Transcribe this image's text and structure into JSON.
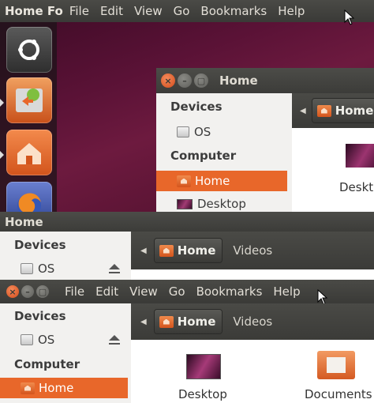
{
  "panel1": {
    "topbar": {
      "app_title": "Home Fo",
      "menu": [
        "File",
        "Edit",
        "View",
        "Go",
        "Bookmarks",
        "Help"
      ]
    },
    "window": {
      "title": "Home",
      "sidebar": {
        "devices_header": "Devices",
        "os_label": "OS",
        "computer_header": "Computer",
        "home_label": "Home",
        "desktop_label": "Desktop"
      },
      "breadcrumb": "Home",
      "content_item": "Deskt"
    }
  },
  "panel2": {
    "title": "Home",
    "sidebar": {
      "devices_header": "Devices",
      "os_label": "OS"
    },
    "breadcrumb": [
      "Home",
      "Videos"
    ]
  },
  "panel3": {
    "menu": [
      "File",
      "Edit",
      "View",
      "Go",
      "Bookmarks",
      "Help"
    ],
    "sidebar": {
      "devices_header": "Devices",
      "os_label": "OS",
      "computer_header": "Computer",
      "home_label": "Home"
    },
    "breadcrumb": [
      "Home",
      "Videos"
    ],
    "content_items": [
      "Desktop",
      "Documents"
    ]
  },
  "colors": {
    "accent": "#e8672a",
    "panel": "#3c3b37",
    "desktop": "#5a1236"
  }
}
